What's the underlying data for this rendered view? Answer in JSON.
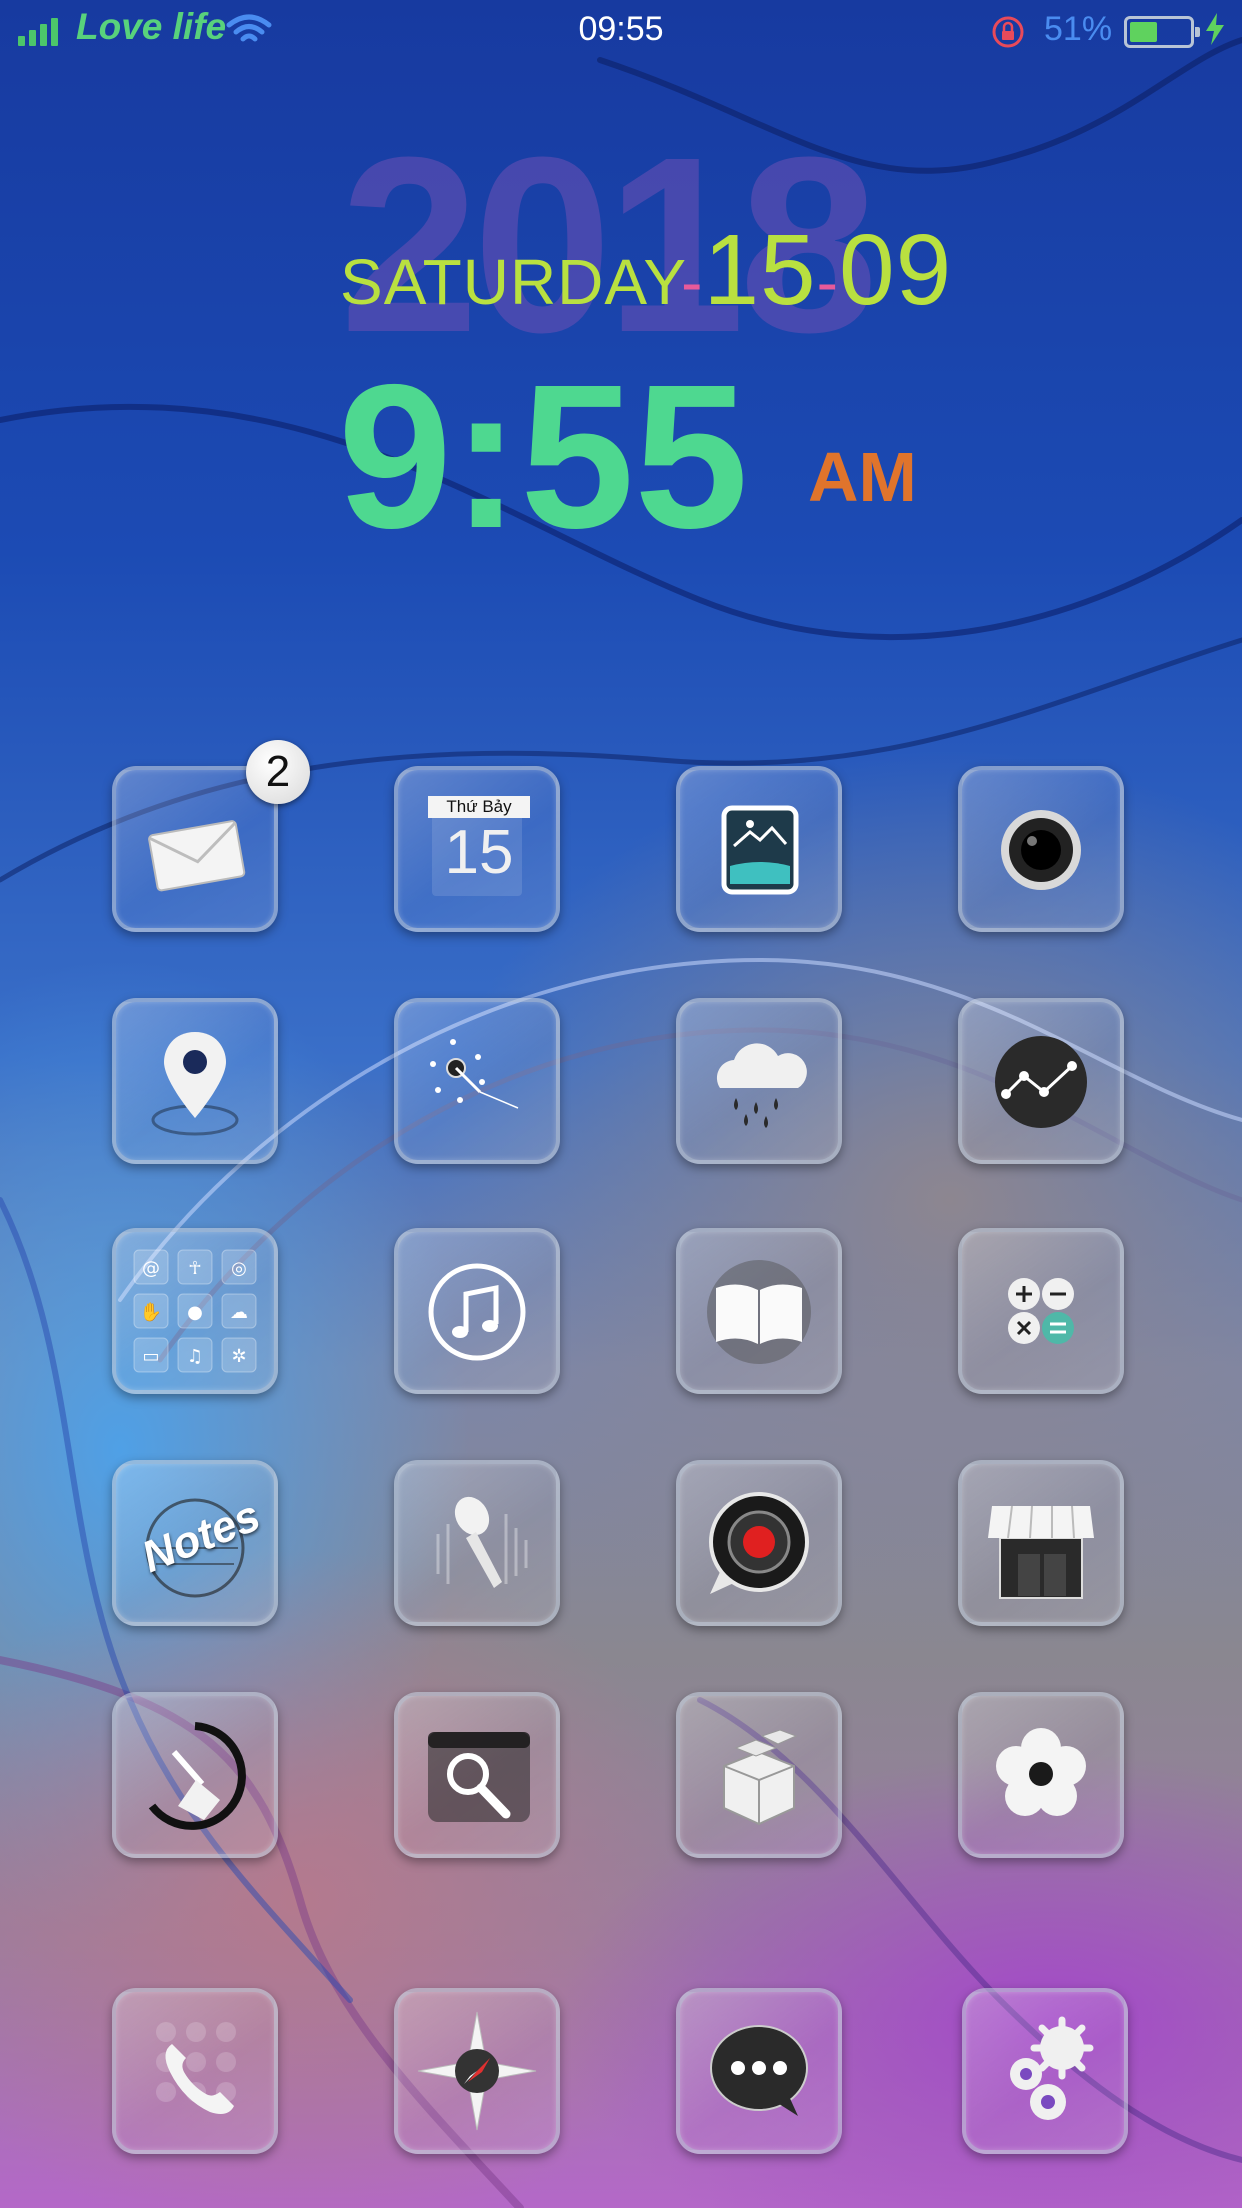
{
  "status_bar": {
    "carrier": "Love life",
    "time": "09:55",
    "battery_percent": "51%",
    "battery_level": 0.51,
    "signal_bars": 4,
    "icons": [
      "signal-icon",
      "wifi-icon",
      "rotation-lock-icon",
      "battery-icon",
      "charging-icon"
    ]
  },
  "widget": {
    "year": "2018",
    "weekday": "SATURDAY",
    "day": "15",
    "month": "09",
    "separator": "-",
    "time": "9:55",
    "ampm": "AM"
  },
  "home": {
    "mail_badge": "2",
    "calendar_weekday": "Thứ Bảy",
    "calendar_day": "15",
    "notes_label": "Notes",
    "icons": [
      {
        "name": "mail-icon"
      },
      {
        "name": "calendar-icon"
      },
      {
        "name": "photos-icon"
      },
      {
        "name": "camera-icon"
      },
      {
        "name": "maps-icon"
      },
      {
        "name": "clock-icon"
      },
      {
        "name": "weather-icon"
      },
      {
        "name": "stocks-icon"
      },
      {
        "name": "folder-icon"
      },
      {
        "name": "music-icon"
      },
      {
        "name": "books-icon"
      },
      {
        "name": "calculator-icon"
      },
      {
        "name": "notes-icon"
      },
      {
        "name": "voice-memos-icon"
      },
      {
        "name": "video-recorder-icon"
      },
      {
        "name": "store-icon"
      },
      {
        "name": "cleaner-icon"
      },
      {
        "name": "search-icon"
      },
      {
        "name": "cydia-icon"
      },
      {
        "name": "flower-icon"
      }
    ],
    "dock": [
      {
        "name": "phone-icon"
      },
      {
        "name": "safari-icon"
      },
      {
        "name": "messages-icon"
      },
      {
        "name": "settings-icon"
      }
    ]
  },
  "colors": {
    "carrier": "#58d27c",
    "weekday": "#b9e040",
    "time": "#4ed890",
    "ampm": "#e0742c",
    "battery_pct": "#4a8cf0"
  }
}
